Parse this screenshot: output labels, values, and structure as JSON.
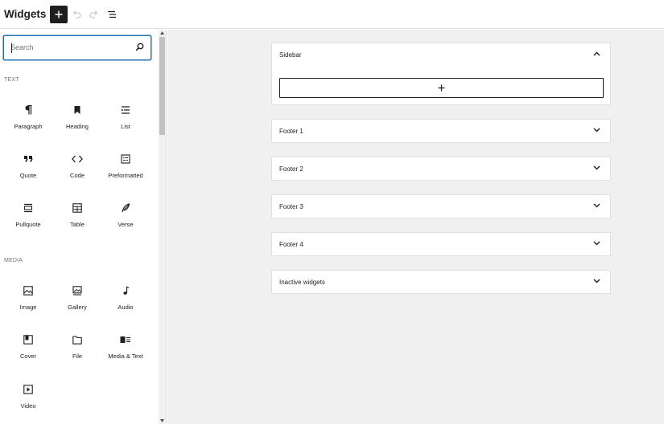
{
  "header": {
    "title": "Widgets",
    "add_icon": "plus-icon",
    "undo_icon": "undo-icon",
    "redo_icon": "redo-icon",
    "list_view_icon": "list-view-icon"
  },
  "inserter": {
    "search": {
      "placeholder": "Search",
      "value": ""
    },
    "sections": [
      {
        "label": "TEXT",
        "items": [
          {
            "label": "Paragraph",
            "icon": "paragraph-icon"
          },
          {
            "label": "Heading",
            "icon": "heading-bookmark-icon"
          },
          {
            "label": "List",
            "icon": "list-icon"
          },
          {
            "label": "Quote",
            "icon": "quote-icon"
          },
          {
            "label": "Code",
            "icon": "code-icon"
          },
          {
            "label": "Preformatted",
            "icon": "preformatted-icon"
          },
          {
            "label": "Pullquote",
            "icon": "pullquote-icon"
          },
          {
            "label": "Table",
            "icon": "table-icon"
          },
          {
            "label": "Verse",
            "icon": "verse-quill-icon"
          }
        ]
      },
      {
        "label": "MEDIA",
        "items": [
          {
            "label": "Image",
            "icon": "image-icon"
          },
          {
            "label": "Gallery",
            "icon": "gallery-icon"
          },
          {
            "label": "Audio",
            "icon": "audio-note-icon"
          },
          {
            "label": "Cover",
            "icon": "cover-icon"
          },
          {
            "label": "File",
            "icon": "folder-icon"
          },
          {
            "label": "Media & Text",
            "icon": "media-text-icon"
          },
          {
            "label": "Video",
            "icon": "video-icon"
          }
        ]
      }
    ]
  },
  "widget_areas": [
    {
      "label": "Sidebar",
      "expanded": true
    },
    {
      "label": "Footer 1",
      "expanded": false
    },
    {
      "label": "Footer 2",
      "expanded": false
    },
    {
      "label": "Footer 3",
      "expanded": false
    },
    {
      "label": "Footer 4",
      "expanded": false
    },
    {
      "label": "Inactive widgets",
      "expanded": false
    }
  ],
  "colors": {
    "text": "#1e1e1e",
    "muted": "#757575",
    "focus_border": "#2271b1",
    "canvas": "#f0f0f0",
    "border": "#e0e0e0"
  }
}
